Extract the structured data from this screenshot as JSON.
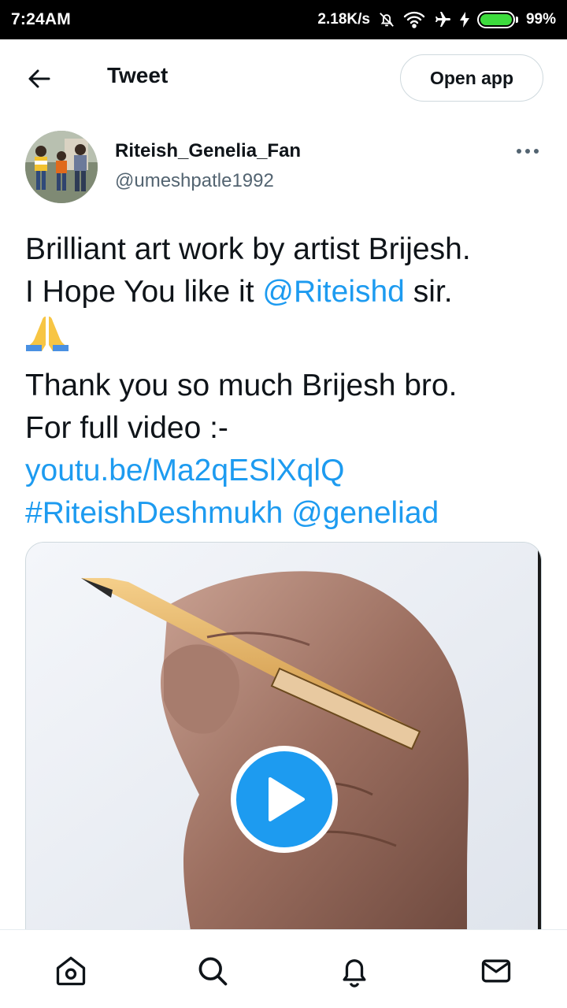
{
  "status_bar": {
    "time": "7:24AM",
    "net_speed": "2.18K/s",
    "battery": "99%",
    "battery_level": 0.99,
    "icons": [
      "mute-bell-icon",
      "wifi-icon",
      "airplane-icon",
      "charging-bolt-icon",
      "battery-icon"
    ]
  },
  "header": {
    "title": "Tweet",
    "open_app_label": "Open app"
  },
  "tweet": {
    "display_name": "Riteish_Genelia_Fan",
    "handle": "@umeshpatle1992",
    "line1": "Brilliant art work by artist Brijesh.",
    "line2_prefix": "I Hope You like it ",
    "line2_mention": "@Riteishd",
    "line2_suffix": " sir.",
    "line3_emoji": "folded-hands-emoji",
    "line4": "Thank you so much Brijesh bro.",
    "line5": "For full video :-",
    "link": "youtu.be/Ma2qESlXqlQ",
    "hashtag": "#RiteishDeshmukh",
    "mention2": "@geneliad"
  },
  "media": {
    "type": "video",
    "play_icon": "play-icon"
  },
  "bottom_nav": [
    "home-icon",
    "search-icon",
    "notifications-icon",
    "messages-icon"
  ],
  "colors": {
    "accent": "#1d9bf0",
    "text": "#0f1419",
    "secondary": "#536471",
    "border": "#cfd9de",
    "battery": "#3ddc3d"
  }
}
